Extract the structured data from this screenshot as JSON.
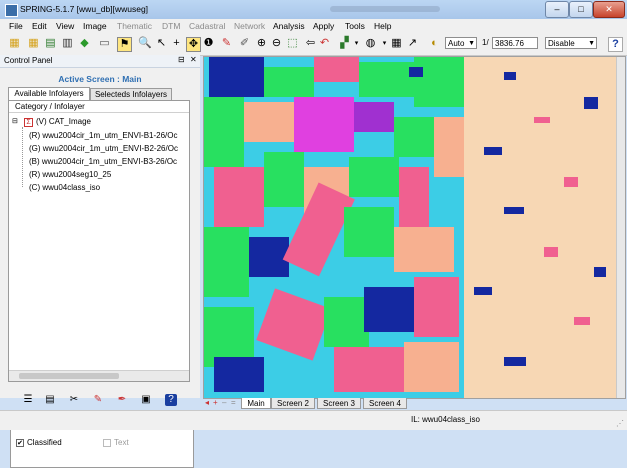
{
  "window": {
    "title": "SPRING-5.1.7 [wwu_db][wwuseg]",
    "minimize": "–",
    "maximize": "□",
    "close": "✕"
  },
  "menu": [
    "File",
    "Edit",
    "View",
    "Image",
    "Thematic",
    "DTM",
    "Cadastral",
    "Network",
    "Analysis",
    "Apply",
    "Tools",
    "Help"
  ],
  "toolbar": {
    "scale_mode": "Auto",
    "scale_prefix": "1/",
    "scale_value": "3836.76",
    "cursor_mode": "Disable"
  },
  "control_panel": {
    "title": "Control Panel",
    "active_screen": "Active Screen : Main",
    "tabs": [
      "Available Infolayers",
      "Selecteds Infolayers"
    ],
    "tree_header": "Category / Infolayer",
    "category": "(V) CAT_Image",
    "items": [
      "(R) wwu2004cir_1m_utm_ENVI-B1-26/Oc",
      "(G) wwu2004cir_1m_utm_ENVI-B2-26/Oc",
      "(B) wwu2004cir_1m_utm_ENVI-B3-26/Oc",
      "(R) wwu2004seg10_25",
      "(C) wwu04class_iso"
    ],
    "checkbox_classified": "Classified",
    "checkbox_text": "Text"
  },
  "screens": [
    "Main",
    "Screen 2",
    "Screen 3",
    "Screen 4"
  ],
  "status": "IL: wwu04class_iso",
  "colors": {
    "accent": "#2f6fb2",
    "map_left": "#3ccde6",
    "map_right": "#f7d7b4"
  }
}
